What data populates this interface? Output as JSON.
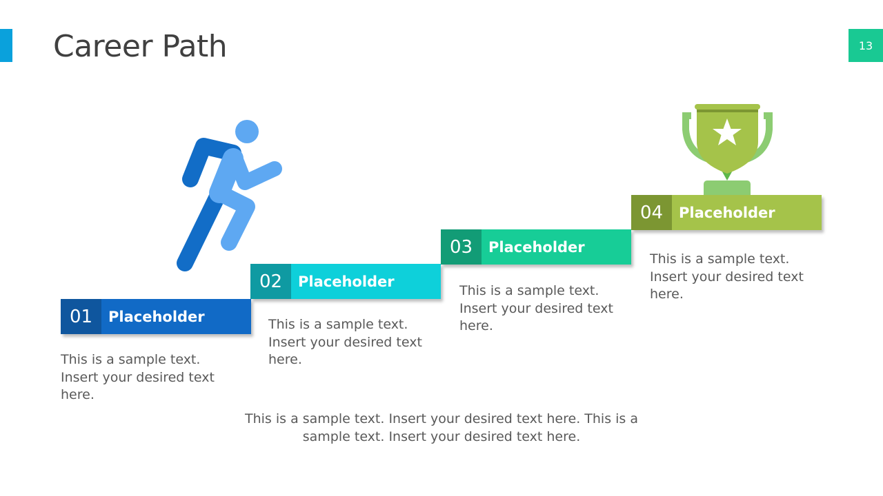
{
  "slide": {
    "title": "Career Path",
    "page_number": "13",
    "accent_color": "#0aa1dc",
    "page_badge_color": "#19c993"
  },
  "steps": [
    {
      "number": "01",
      "label": "Placeholder",
      "description": "This is a sample text. Insert your desired text here.",
      "num_color": "#0f569e",
      "label_color": "#116ac6"
    },
    {
      "number": "02",
      "label": "Placeholder",
      "description": "This is a sample text. Insert your desired text here.",
      "num_color": "#0f9aa2",
      "label_color": "#0ed0da"
    },
    {
      "number": "03",
      "label": "Placeholder",
      "description": "This is a sample text. Insert your desired text here.",
      "num_color": "#129c76",
      "label_color": "#17cd97"
    },
    {
      "number": "04",
      "label": "Placeholder",
      "description": "This is a sample text. Insert your desired text here.",
      "num_color": "#7c9632",
      "label_color": "#a5c34a"
    }
  ],
  "icons": {
    "runner": "running-person-icon",
    "trophy": "trophy-star-icon"
  },
  "footer_text": "This is a sample text. Insert your desired text here. This is a sample text. Insert your desired text here."
}
